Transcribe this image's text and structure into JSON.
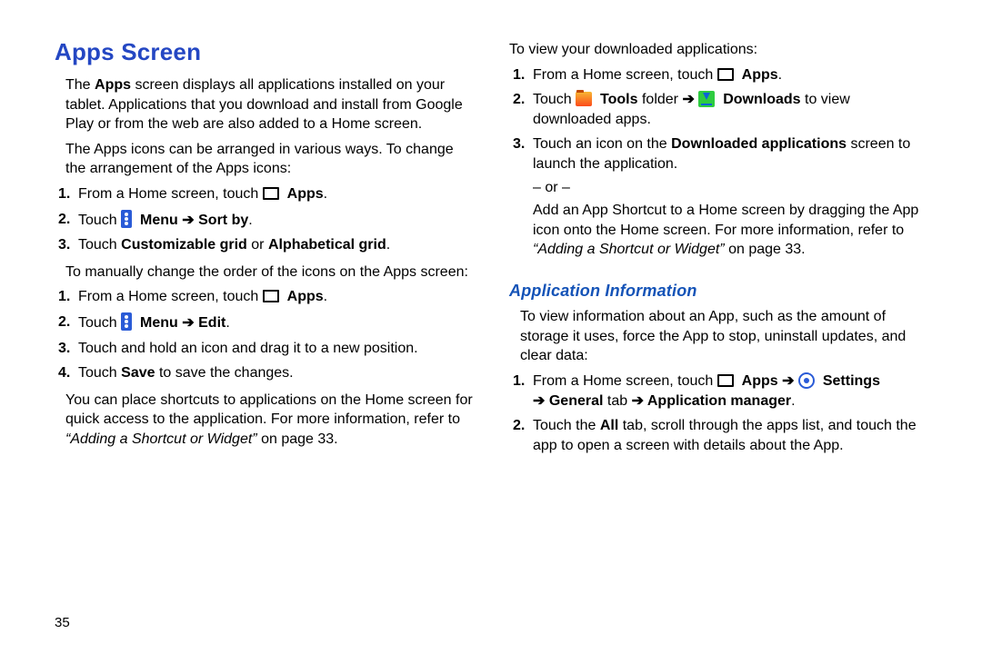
{
  "page_number": "35",
  "h1": "Apps Screen",
  "p1": "The Apps screen displays all applications installed on your tablet. Applications that you download and install from Google Play or from the web are also added to a Home screen.",
  "p1_bold": "Apps",
  "p2": "The Apps icons can be arranged in various ways. To change the arrangement of the Apps icons:",
  "stepsA": {
    "1_pre": "From a Home screen, touch ",
    "1_bold": "Apps",
    "1_post": ".",
    "2_pre": "Touch ",
    "2_bold1": "Menu",
    "2_arrow": " ➔ ",
    "2_bold2": "Sort by",
    "2_post": ".",
    "3_pre": "Touch ",
    "3_bold1": "Customizable grid",
    "3_mid": " or ",
    "3_bold2": "Alphabetical grid",
    "3_post": "."
  },
  "p3": "To manually change the order of the icons on the Apps screen:",
  "stepsB": {
    "1_pre": "From a Home screen, touch ",
    "1_bold": "Apps",
    "1_post": ".",
    "2_pre": "Touch ",
    "2_bold1": "Menu",
    "2_arrow": " ➔ ",
    "2_bold2": "Edit",
    "2_post": ".",
    "3": "Touch and hold an icon and drag it to a new position.",
    "4_pre": "Touch ",
    "4_bold": "Save",
    "4_post": " to save the changes."
  },
  "p4a": "You can place shortcuts to applications on the Home screen for quick access to the application. For more information, refer to ",
  "p4_ref": "“Adding a Shortcut or Widget”",
  "p4b": " on page 33.",
  "r_p1": "To view your downloaded applications:",
  "stepsC": {
    "1_pre": "From a Home screen, touch ",
    "1_bold": "Apps",
    "1_post": ".",
    "2_pre": "Touch ",
    "2_bold1": "Tools",
    "2_mid1": " folder ",
    "2_arrow": "➔ ",
    "2_bold2": "Downloads",
    "2_post": " to view downloaded apps.",
    "3_pre": "Touch an icon on the ",
    "3_bold": "Downloaded applications",
    "3_post": " screen to launch the application.",
    "or": "– or –",
    "3b_a": "Add an App Shortcut to a Home screen by dragging the App icon onto the Home screen. For more information, refer to ",
    "3b_ref": "“Adding a Shortcut or Widget”",
    "3b_b": " on page 33."
  },
  "h2": "Application Information",
  "r_p2": "To view information about an App, such as the amount of storage it uses, force the App to stop, uninstall updates, and clear data:",
  "stepsD": {
    "1_pre": "From a Home screen, touch ",
    "1_bold1": "Apps",
    "1_arrow1": " ➔ ",
    "1_bold2": "Settings",
    "1_arrow2": " ➔ ",
    "1_bold3": "General",
    "1_mid": " tab ",
    "1_arrow3": "➔ ",
    "1_bold4": "Application manager",
    "1_post": ".",
    "2_pre": "Touch the ",
    "2_bold": "All",
    "2_post": " tab, scroll through the apps list, and touch the app to open a screen with details about the App."
  },
  "nums": {
    "n1": "1.",
    "n2": "2.",
    "n3": "3.",
    "n4": "4."
  }
}
